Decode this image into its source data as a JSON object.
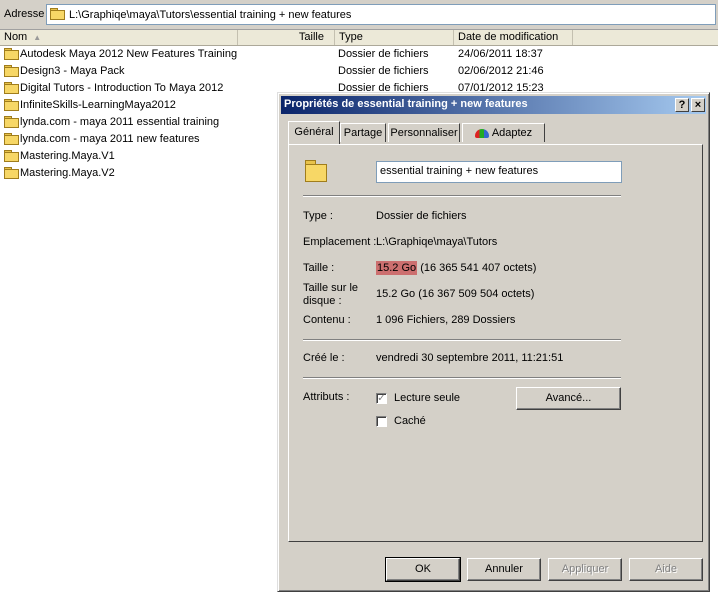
{
  "address": {
    "label": "Adresse",
    "path": "L:\\Graphiqe\\maya\\Tutors\\essential training + new features"
  },
  "columns": {
    "name": "Nom",
    "size": "Taille",
    "type": "Type",
    "date": "Date de modification"
  },
  "files": [
    {
      "name": "Autodesk Maya 2012 New Features Training",
      "type": "Dossier de fichiers",
      "date": "24/06/2011 18:37"
    },
    {
      "name": "Design3 - Maya Pack",
      "type": "Dossier de fichiers",
      "date": "02/06/2012 21:46"
    },
    {
      "name": "Digital Tutors - Introduction To Maya 2012",
      "type": "Dossier de fichiers",
      "date": "07/01/2012 15:23"
    },
    {
      "name": "InfiniteSkills-LearningMaya2012",
      "type": "",
      "date": ""
    },
    {
      "name": "lynda.com - maya 2011 essential training",
      "type": "",
      "date": ""
    },
    {
      "name": "lynda.com - maya 2011 new features",
      "type": "",
      "date": ""
    },
    {
      "name": "Mastering.Maya.V1",
      "type": "",
      "date": ""
    },
    {
      "name": "Mastering.Maya.V2",
      "type": "",
      "date": ""
    }
  ],
  "dialog": {
    "title": "Propriétés de essential training + new features",
    "help_btn": "?",
    "close_btn": "×",
    "tabs": {
      "general": "Général",
      "partage": "Partage",
      "personnaliser": "Personnaliser",
      "adaptez": "Adaptez"
    },
    "folder_name": "essential training + new features",
    "type_label": "Type :",
    "type_value": "Dossier de fichiers",
    "location_label": "Emplacement :",
    "location_value": "L:\\Graphiqe\\maya\\Tutors",
    "size_label": "Taille :",
    "size_value_main": "15.2 Go",
    "size_value_rest": " (16 365 541 407 octets)",
    "disk_size_label_1": "Taille sur le",
    "disk_size_label_2": "disque :",
    "disk_size_value": "15.2 Go (16 367 509 504 octets)",
    "contents_label": "Contenu :",
    "contents_value": "1 096 Fichiers, 289 Dossiers",
    "created_label": "Créé le :",
    "created_value": "vendredi 30 septembre 2011, 11:21:51",
    "attributes_label": "Attributs :",
    "readonly_label": "Lecture seule",
    "readonly_checked": true,
    "hidden_label": "Caché",
    "hidden_checked": false,
    "advanced_btn": "Avancé...",
    "ok_btn": "OK",
    "cancel_btn": "Annuler",
    "apply_btn": "Appliquer",
    "help_bottom_btn": "Aide"
  }
}
